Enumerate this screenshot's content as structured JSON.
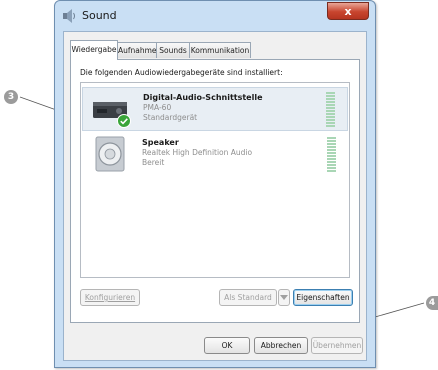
{
  "window": {
    "title": "Sound",
    "close_glyph": "x"
  },
  "tabs": [
    {
      "label": "Wiedergabe",
      "active": true
    },
    {
      "label": "Aufnahme",
      "active": false
    },
    {
      "label": "Sounds",
      "active": false
    },
    {
      "label": "Kommunikation",
      "active": false
    }
  ],
  "panel": {
    "header": "Die folgenden Audiowiedergabegeräte sind installiert:"
  },
  "devices": [
    {
      "name": "Digital-Audio-Schnittstelle",
      "line1": "PMA-60",
      "line2": "Standardgerät",
      "icon": "digital-audio-icon",
      "badge": "default-check-icon",
      "selected": true
    },
    {
      "name": "Speaker",
      "line1": "Realtek High Definition Audio",
      "line2": "Bereit",
      "icon": "speaker-icon",
      "selected": false
    }
  ],
  "buttons": {
    "configure": "Konfigurieren",
    "set_default": "Als Standard",
    "properties": "Eigenschaften",
    "ok": "OK",
    "cancel": "Abbrechen",
    "apply": "Übernehmen"
  },
  "callouts": {
    "left": "3",
    "right": "4"
  },
  "colors": {
    "frame": "#c9dff4",
    "selection": "#e8eef4",
    "check": "#3aa53a",
    "meter": "#7fbf8f",
    "callout": "#9b9b9b"
  }
}
